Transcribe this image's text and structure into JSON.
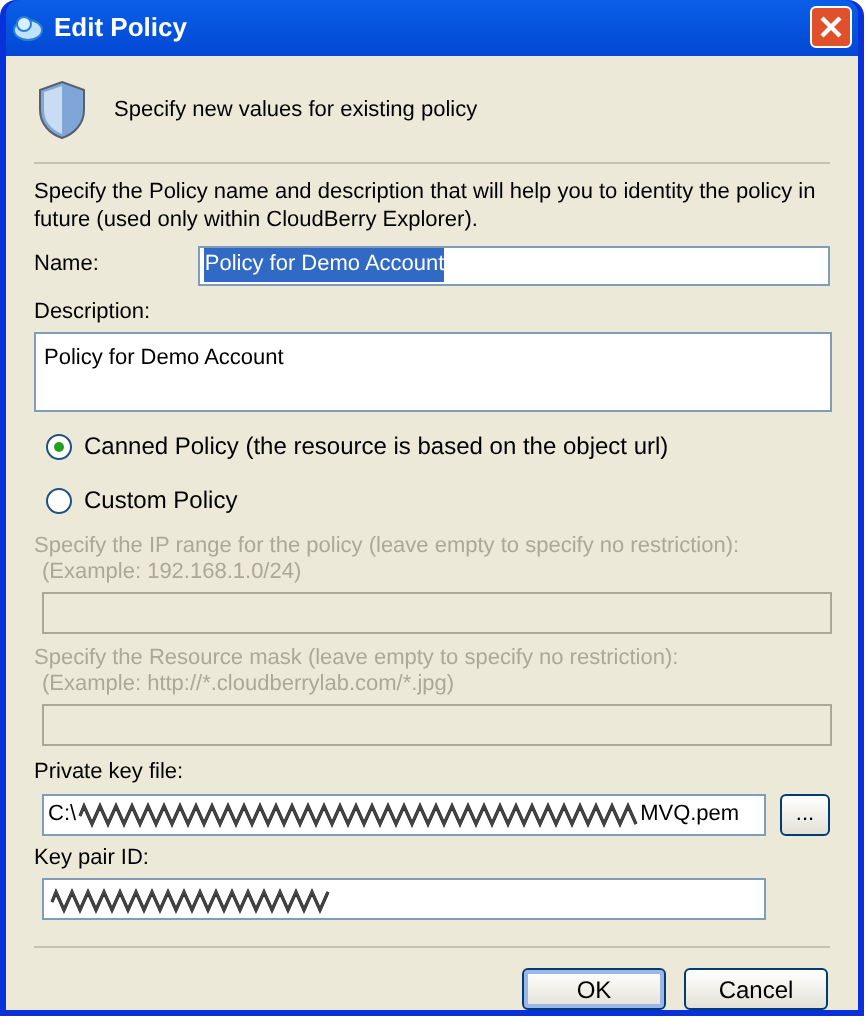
{
  "window": {
    "title": "Edit Policy"
  },
  "header": {
    "text": "Specify new values for existing policy"
  },
  "intro": "Specify the Policy name and description that will help you to identity the policy in future (used only within CloudBerry Explorer).",
  "name_field": {
    "label": "Name:",
    "value": "Policy for Demo Account",
    "text_selected": true
  },
  "description_field": {
    "label": "Description:",
    "value": "Policy for Demo Account"
  },
  "policy_type": [
    {
      "label": "Canned Policy (the resource is based on the object url)",
      "selected": true
    },
    {
      "label": "Custom Policy",
      "selected": false
    }
  ],
  "ip_range": {
    "label": "Specify the IP range for the policy (leave empty to specify no restriction):",
    "example": "(Example: 192.168.1.0/24)",
    "disabled": true
  },
  "resource_mask": {
    "label": "Specify the Resource mask (leave empty to specify no restriction):",
    "example": "(Example: http://*.cloudberrylab.com/*.jpg)",
    "disabled": true
  },
  "private_key_file": {
    "label": "Private key file:",
    "value_start": "C:\\",
    "value_end": "MVQ.pem",
    "browse_button": "..."
  },
  "key_pair_id": {
    "label": "Key pair ID:"
  },
  "buttons": [
    {
      "label": "OK",
      "default": true
    },
    {
      "label": "Cancel",
      "default": false
    }
  ]
}
